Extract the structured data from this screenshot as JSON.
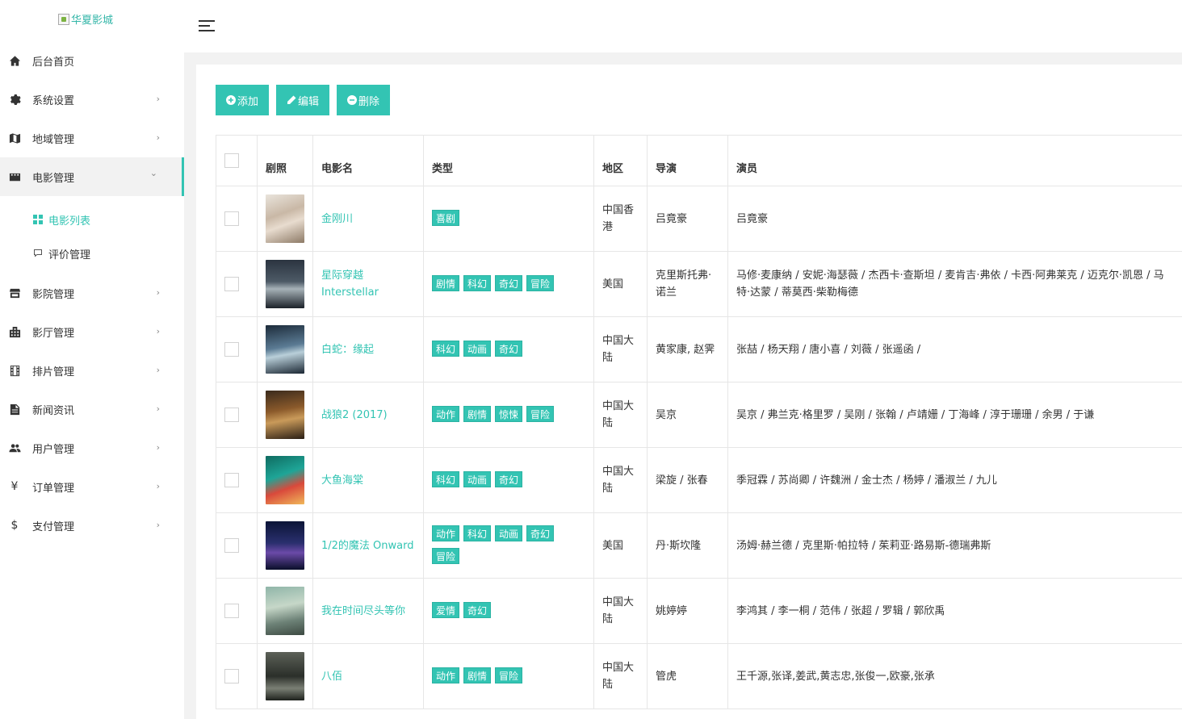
{
  "logo": {
    "alt_text": "华夏影城"
  },
  "sidebar": {
    "items": [
      {
        "label": "后台首页",
        "icon": "home-icon",
        "has_arrow": false
      },
      {
        "label": "系统设置",
        "icon": "gear-icon",
        "has_arrow": true
      },
      {
        "label": "地域管理",
        "icon": "map-icon",
        "has_arrow": true
      },
      {
        "label": "电影管理",
        "icon": "film-icon",
        "has_arrow": true,
        "open": true
      },
      {
        "label": "影院管理",
        "icon": "store-icon",
        "has_arrow": true
      },
      {
        "label": "影厅管理",
        "icon": "building-icon",
        "has_arrow": true
      },
      {
        "label": "排片管理",
        "icon": "film-strip-icon",
        "has_arrow": true
      },
      {
        "label": "新闻资讯",
        "icon": "news-icon",
        "has_arrow": true
      },
      {
        "label": "用户管理",
        "icon": "users-icon",
        "has_arrow": true
      },
      {
        "label": "订单管理",
        "icon": "yen-icon",
        "has_arrow": true
      },
      {
        "label": "支付管理",
        "icon": "dollar-icon",
        "has_arrow": true
      }
    ],
    "submenu": [
      {
        "label": "电影列表",
        "icon": "grid-icon",
        "active": true
      },
      {
        "label": "评价管理",
        "icon": "comment-icon",
        "active": false
      }
    ],
    "arrow_right": "›",
    "arrow_down": "⌄"
  },
  "toolbar": {
    "add_label": "添加",
    "edit_label": "编辑",
    "delete_label": "删除"
  },
  "table": {
    "headers": [
      "",
      "剧照",
      "电影名",
      "类型",
      "地区",
      "导演",
      "演员"
    ],
    "rows": [
      {
        "name": "金刚川",
        "tags": [
          "喜剧"
        ],
        "region": "中国香港",
        "director": "吕竟豪",
        "actors": "吕竟豪"
      },
      {
        "name": "星际穿越 Interstellar",
        "tags": [
          "剧情",
          "科幻",
          "奇幻",
          "冒险"
        ],
        "region": "美国",
        "director": "克里斯托弗·诺兰",
        "actors": "马修·麦康纳 / 安妮·海瑟薇 / 杰西卡·查斯坦 / 麦肯吉·弗依 / 卡西·阿弗莱克 / 迈克尔·凯恩 / 马特·达蒙 / 蒂莫西·柴勒梅德"
      },
      {
        "name": "白蛇：缘起",
        "tags": [
          "科幻",
          "动画",
          "奇幻"
        ],
        "region": "中国大陆",
        "director": "黄家康, 赵霁",
        "actors": "张喆 / 杨天翔 / 唐小喜 / 刘薇 / 张遥函 /"
      },
      {
        "name": "战狼2 (2017)",
        "tags": [
          "动作",
          "剧情",
          "惊悚",
          "冒险"
        ],
        "region": "中国大陆",
        "director": "吴京",
        "actors": "吴京 / 弗兰克·格里罗 / 吴刚 / 张翰 / 卢靖姗 / 丁海峰 / 淳于珊珊 / 余男 / 于谦"
      },
      {
        "name": "大鱼海棠",
        "tags": [
          "科幻",
          "动画",
          "奇幻"
        ],
        "region": "中国大陆",
        "director": "梁旋 / 张春",
        "actors": "季冠霖 / 苏尚卿 / 许魏洲 / 金士杰 / 杨婷 / 潘淑兰 / 九儿"
      },
      {
        "name": "1/2的魔法 Onward",
        "tags": [
          "动作",
          "科幻",
          "动画",
          "奇幻",
          "冒险"
        ],
        "region": "美国",
        "director": "丹·斯坎隆",
        "actors": "汤姆·赫兰德 / 克里斯·帕拉特 / 茱莉亚·路易斯-德瑞弗斯"
      },
      {
        "name": "我在时间尽头等你",
        "tags": [
          "爱情",
          "奇幻"
        ],
        "region": "中国大陆",
        "director": "姚婷婷",
        "actors": "李鸿其 / 李一桐 / 范伟 / 张超 / 罗辑 / 郭欣禹"
      },
      {
        "name": "八佰",
        "tags": [
          "动作",
          "剧情",
          "冒险"
        ],
        "region": "中国大陆",
        "director": "管虎",
        "actors": "王千源,张译,姜武,黄志忠,张俊一,欧豪,张承"
      }
    ]
  },
  "colors": {
    "accent": "#33c4b3"
  }
}
